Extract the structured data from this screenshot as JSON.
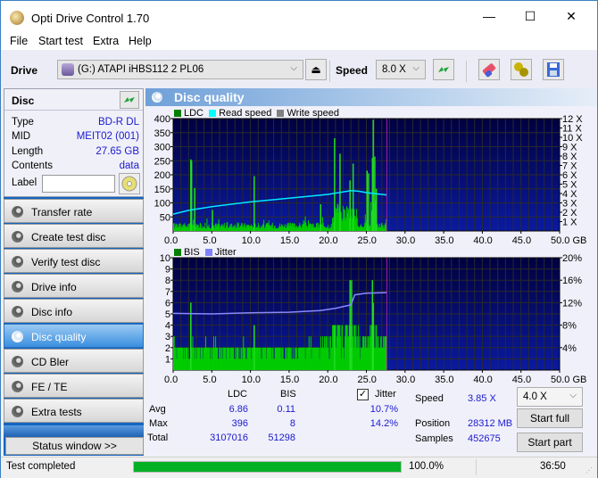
{
  "window": {
    "title": "Opti Drive Control 1.70",
    "minimize": "—",
    "maximize": "☐",
    "close": "✕"
  },
  "menu": [
    "File",
    "Start test",
    "Extra",
    "Help"
  ],
  "toolbar": {
    "drive_label": "Drive",
    "drive_value": "(G:)  ATAPI iHBS112  2 PL06",
    "speed_label": "Speed",
    "speed_value": "8.0 X"
  },
  "disc": {
    "header": "Disc",
    "rows": [
      {
        "key": "Type",
        "value": "BD-R DL"
      },
      {
        "key": "MID",
        "value": "MEIT02 (001)"
      },
      {
        "key": "Length",
        "value": "27.65 GB"
      },
      {
        "key": "Contents",
        "value": "data"
      }
    ],
    "label_key": "Label",
    "label_value": ""
  },
  "nav": [
    {
      "label": "Transfer rate",
      "active": false
    },
    {
      "label": "Create test disc",
      "active": false
    },
    {
      "label": "Verify test disc",
      "active": false
    },
    {
      "label": "Drive info",
      "active": false
    },
    {
      "label": "Disc info",
      "active": false
    },
    {
      "label": "Disc quality",
      "active": true
    },
    {
      "label": "CD Bler",
      "active": false
    },
    {
      "label": "FE / TE",
      "active": false
    },
    {
      "label": "Extra tests",
      "active": false
    }
  ],
  "status_window_button": "Status window >>",
  "panel": {
    "title": "Disc quality"
  },
  "chart_data": [
    {
      "type": "bar",
      "title": "LDC",
      "legend": [
        {
          "name": "LDC",
          "color": "#008000"
        },
        {
          "name": "Read speed",
          "color": "#00ffff"
        },
        {
          "name": "Write speed",
          "color": "#808080"
        }
      ],
      "xlabel": "GB",
      "x_ticks": [
        "0.0",
        "5.0",
        "10.0",
        "15.0",
        "20.0",
        "25.0",
        "30.0",
        "35.0",
        "40.0",
        "45.0",
        "50.0 GB"
      ],
      "xlim": [
        0,
        50
      ],
      "y_left_ticks": [
        "400",
        "350",
        "300",
        "250",
        "200",
        "150",
        "100",
        "50"
      ],
      "ylim_left": [
        0,
        400
      ],
      "y_right_ticks": [
        "12 X",
        "11 X",
        "10 X",
        "9 X",
        "8 X",
        "7 X",
        "6 X",
        "5 X",
        "4 X",
        "3 X",
        "2 X",
        "1 X"
      ],
      "ylim_right": [
        0,
        12
      ],
      "end_marker_gb": 27.65,
      "series": [
        {
          "name": "LDC",
          "note": "baseline ~5-40 with spikes",
          "spikes": [
            [
              2.2,
              255
            ],
            [
              2.3,
              250
            ],
            [
              2.7,
              153
            ],
            [
              5.0,
              75
            ],
            [
              10.4,
              195
            ],
            [
              19.0,
              95
            ],
            [
              20.8,
              330
            ],
            [
              21.5,
              275
            ],
            [
              22.8,
              180
            ],
            [
              23.2,
              240
            ],
            [
              25.0,
              215
            ],
            [
              25.2,
              205
            ],
            [
              25.7,
              260
            ],
            [
              25.8,
              396
            ],
            [
              26.0,
              265
            ],
            [
              26.2,
              150
            ]
          ],
          "baseline_max": 40
        },
        {
          "name": "Read speed",
          "points": [
            [
              0,
              1.8
            ],
            [
              2,
              2.2
            ],
            [
              5,
              2.6
            ],
            [
              10,
              3.1
            ],
            [
              15,
              3.5
            ],
            [
              20,
              3.9
            ],
            [
              23,
              4.3
            ],
            [
              24,
              4.25
            ],
            [
              25,
              4.1
            ],
            [
              27.65,
              3.85
            ]
          ]
        }
      ]
    },
    {
      "type": "bar",
      "title": "BIS",
      "legend": [
        {
          "name": "BIS",
          "color": "#008000"
        },
        {
          "name": "Jitter",
          "color": "#8080ff"
        }
      ],
      "xlabel": "GB",
      "x_ticks": [
        "0.0",
        "5.0",
        "10.0",
        "15.0",
        "20.0",
        "25.0",
        "30.0",
        "35.0",
        "40.0",
        "45.0",
        "50.0 GB"
      ],
      "xlim": [
        0,
        50
      ],
      "y_left_ticks": [
        "10",
        "9",
        "8",
        "7",
        "6",
        "5",
        "4",
        "3",
        "2",
        "1"
      ],
      "ylim_left": [
        0,
        10
      ],
      "y_right_ticks": [
        "20%",
        "16%",
        "12%",
        "8%",
        "4%"
      ],
      "ylim_right": [
        0,
        20
      ],
      "end_marker_gb": 27.65,
      "series": [
        {
          "name": "BIS",
          "note": "mostly 1-2, up to 3-4 after 19GB, spikes to 8",
          "spikes": [
            [
              2.2,
              6
            ],
            [
              2.2,
              5
            ],
            [
              10.4,
              4
            ],
            [
              20.8,
              4
            ],
            [
              22.8,
              8
            ],
            [
              23.0,
              8
            ],
            [
              25.7,
              8
            ],
            [
              25.8,
              6
            ]
          ]
        },
        {
          "name": "Jitter",
          "points": [
            [
              0,
              10.1
            ],
            [
              5,
              10.0
            ],
            [
              10,
              10.2
            ],
            [
              15,
              10.3
            ],
            [
              19,
              10.6
            ],
            [
              21,
              11.0
            ],
            [
              23,
              11.6
            ],
            [
              23.5,
              13.4
            ],
            [
              25,
              13.7
            ],
            [
              27.65,
              13.8
            ]
          ]
        }
      ]
    }
  ],
  "stats": {
    "col_ldc": "LDC",
    "col_bis": "BIS",
    "jitter_label": "Jitter",
    "jitter_checked": true,
    "rows": [
      {
        "label": "Avg",
        "ldc": "6.86",
        "bis": "0.11",
        "jitter": "10.7%"
      },
      {
        "label": "Max",
        "ldc": "396",
        "bis": "8",
        "jitter": "14.2%"
      },
      {
        "label": "Total",
        "ldc": "3107016",
        "bis": "51298",
        "jitter": ""
      }
    ],
    "speed_label": "Speed",
    "speed_value": "3.85 X",
    "position_label": "Position",
    "position_value": "28312 MB",
    "samples_label": "Samples",
    "samples_value": "452675",
    "test_speed": "4.0 X",
    "start_full": "Start full",
    "start_part": "Start part"
  },
  "statusbar": {
    "text": "Test completed",
    "progress_percent": 100,
    "progress_label": "100.0%",
    "time": "36:50"
  }
}
